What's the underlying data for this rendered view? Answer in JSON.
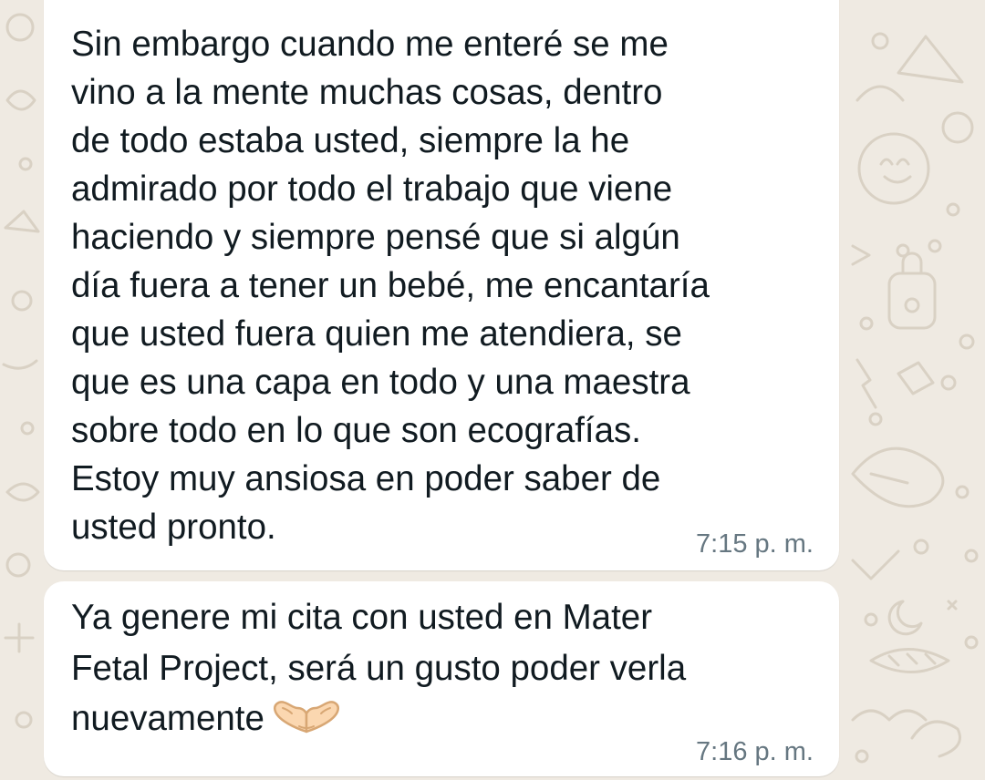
{
  "theme": {
    "wallpaper": "#efeae2",
    "doodle": "#d9d1c4",
    "bubble": "#ffffff",
    "text": "#111b21",
    "timestamp": "#667781"
  },
  "messages": [
    {
      "text": "Sin embargo cuando me enteré se me\nvino a la mente muchas cosas, dentro\nde todo estaba usted, siempre la he\nadmirado por todo el trabajo que viene\nhaciendo y siempre pensé que si algún\ndía fuera a tener un bebé, me encantaría\nque usted fuera quien me atendiera, se\nque es una capa en todo y una maestra\nsobre todo en lo que son ecografías.\nEstoy muy ansiosa en poder saber de\nusted pronto.",
      "time": "7:15 p. m."
    },
    {
      "text": "Ya genere mi cita con usted en Mater\nFetal Project, será un gusto poder verla\nnuevamente",
      "emoji": "heart-hands-emoji",
      "time": "7:16 p. m."
    }
  ]
}
